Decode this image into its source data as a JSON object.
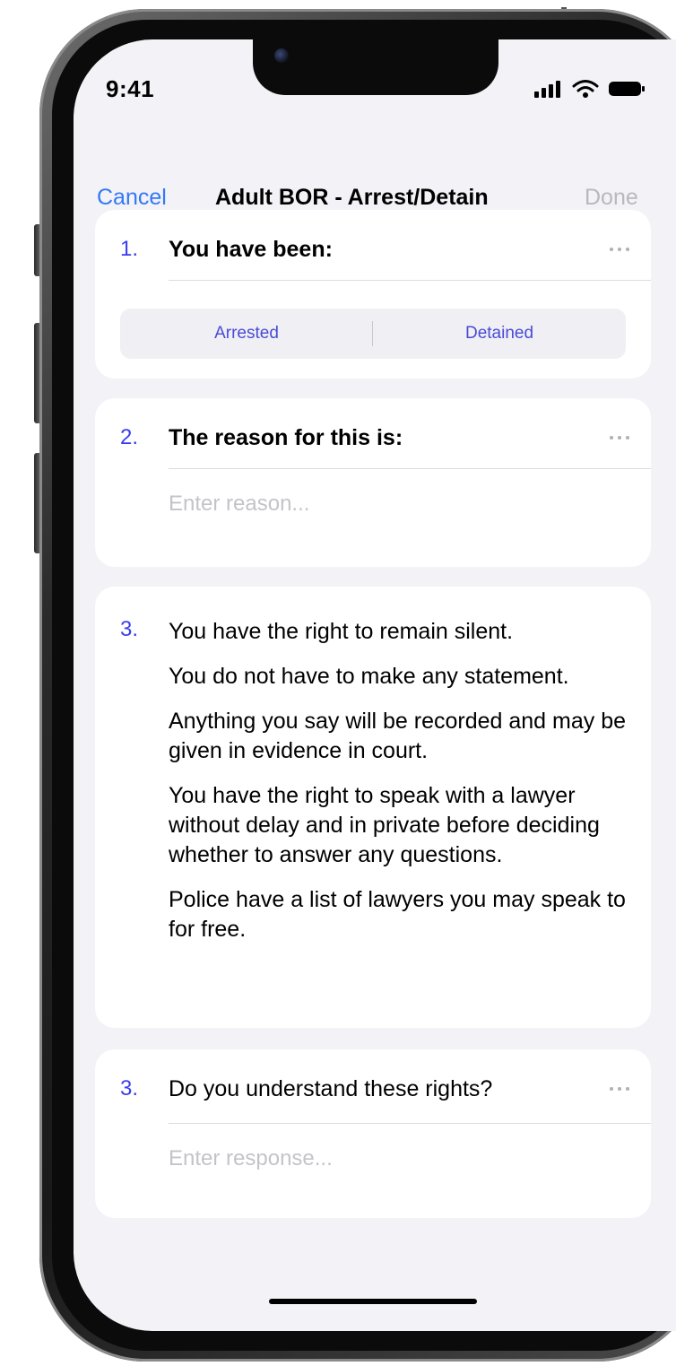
{
  "status_bar": {
    "time": "9:41",
    "icons": [
      "signal-icon",
      "wifi-icon",
      "battery-icon"
    ]
  },
  "nav": {
    "cancel_label": "Cancel",
    "title": "Adult BOR - Arrest/Detain",
    "done_label": "Done"
  },
  "questions": [
    {
      "number": "1.",
      "label": "You have been:",
      "options": [
        "Arrested",
        "Detained"
      ]
    },
    {
      "number": "2.",
      "label": "The reason for this is:",
      "placeholder": "Enter reason..."
    },
    {
      "number": "3.",
      "paragraphs": [
        "You have the right to remain silent.",
        "You do not have to make any statement.",
        "Anything you say will be recorded and may be given in evidence in court.",
        "You have the right to speak with a lawyer without delay and in private before deciding whether to answer any questions.",
        "Police have a list of lawyers you may speak to for free."
      ]
    },
    {
      "number": "3.",
      "label": "Do you understand these rights?",
      "placeholder": "Enter response..."
    }
  ],
  "colors": {
    "accent": "#3478f6",
    "number": "#3a3df0",
    "segment_text": "#4b4bd6",
    "disabled": "#b8b8bd",
    "background": "#f2f2f7"
  }
}
